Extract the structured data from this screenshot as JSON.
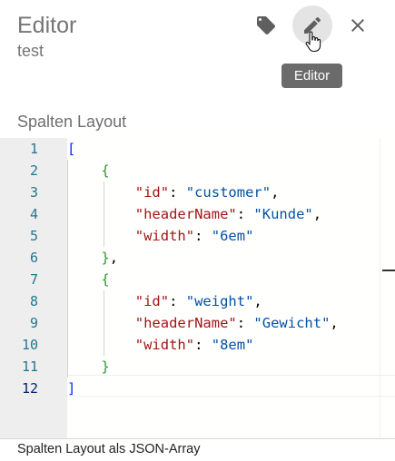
{
  "header": {
    "title": "Editor",
    "subtitle": "test",
    "tooltip": "Editor"
  },
  "field": {
    "label": "Spalten Layout",
    "hint": "Spalten Layout als JSON-Array"
  },
  "editor": {
    "language": "json",
    "active_line": 12,
    "line_numbers": [
      "1",
      "2",
      "3",
      "4",
      "5",
      "6",
      "7",
      "8",
      "9",
      "10",
      "11",
      "12"
    ],
    "lines": [
      "[",
      "    {",
      "        \"id\": \"customer\",",
      "        \"headerName\": \"Kunde\",",
      "        \"width\": \"6em\"",
      "    },",
      "    {",
      "        \"id\": \"weight\",",
      "        \"headerName\": \"Gewicht\",",
      "        \"width\": \"8em\"",
      "    }",
      "]"
    ]
  },
  "colors": {
    "bracket_outer": "#0431fa",
    "bracket_inner": "#319331",
    "json_key": "#a31515",
    "json_string": "#0451a5",
    "line_number": "#237893"
  },
  "icons": [
    "tag-icon",
    "pencil-icon",
    "close-icon",
    "hand-cursor-icon"
  ]
}
